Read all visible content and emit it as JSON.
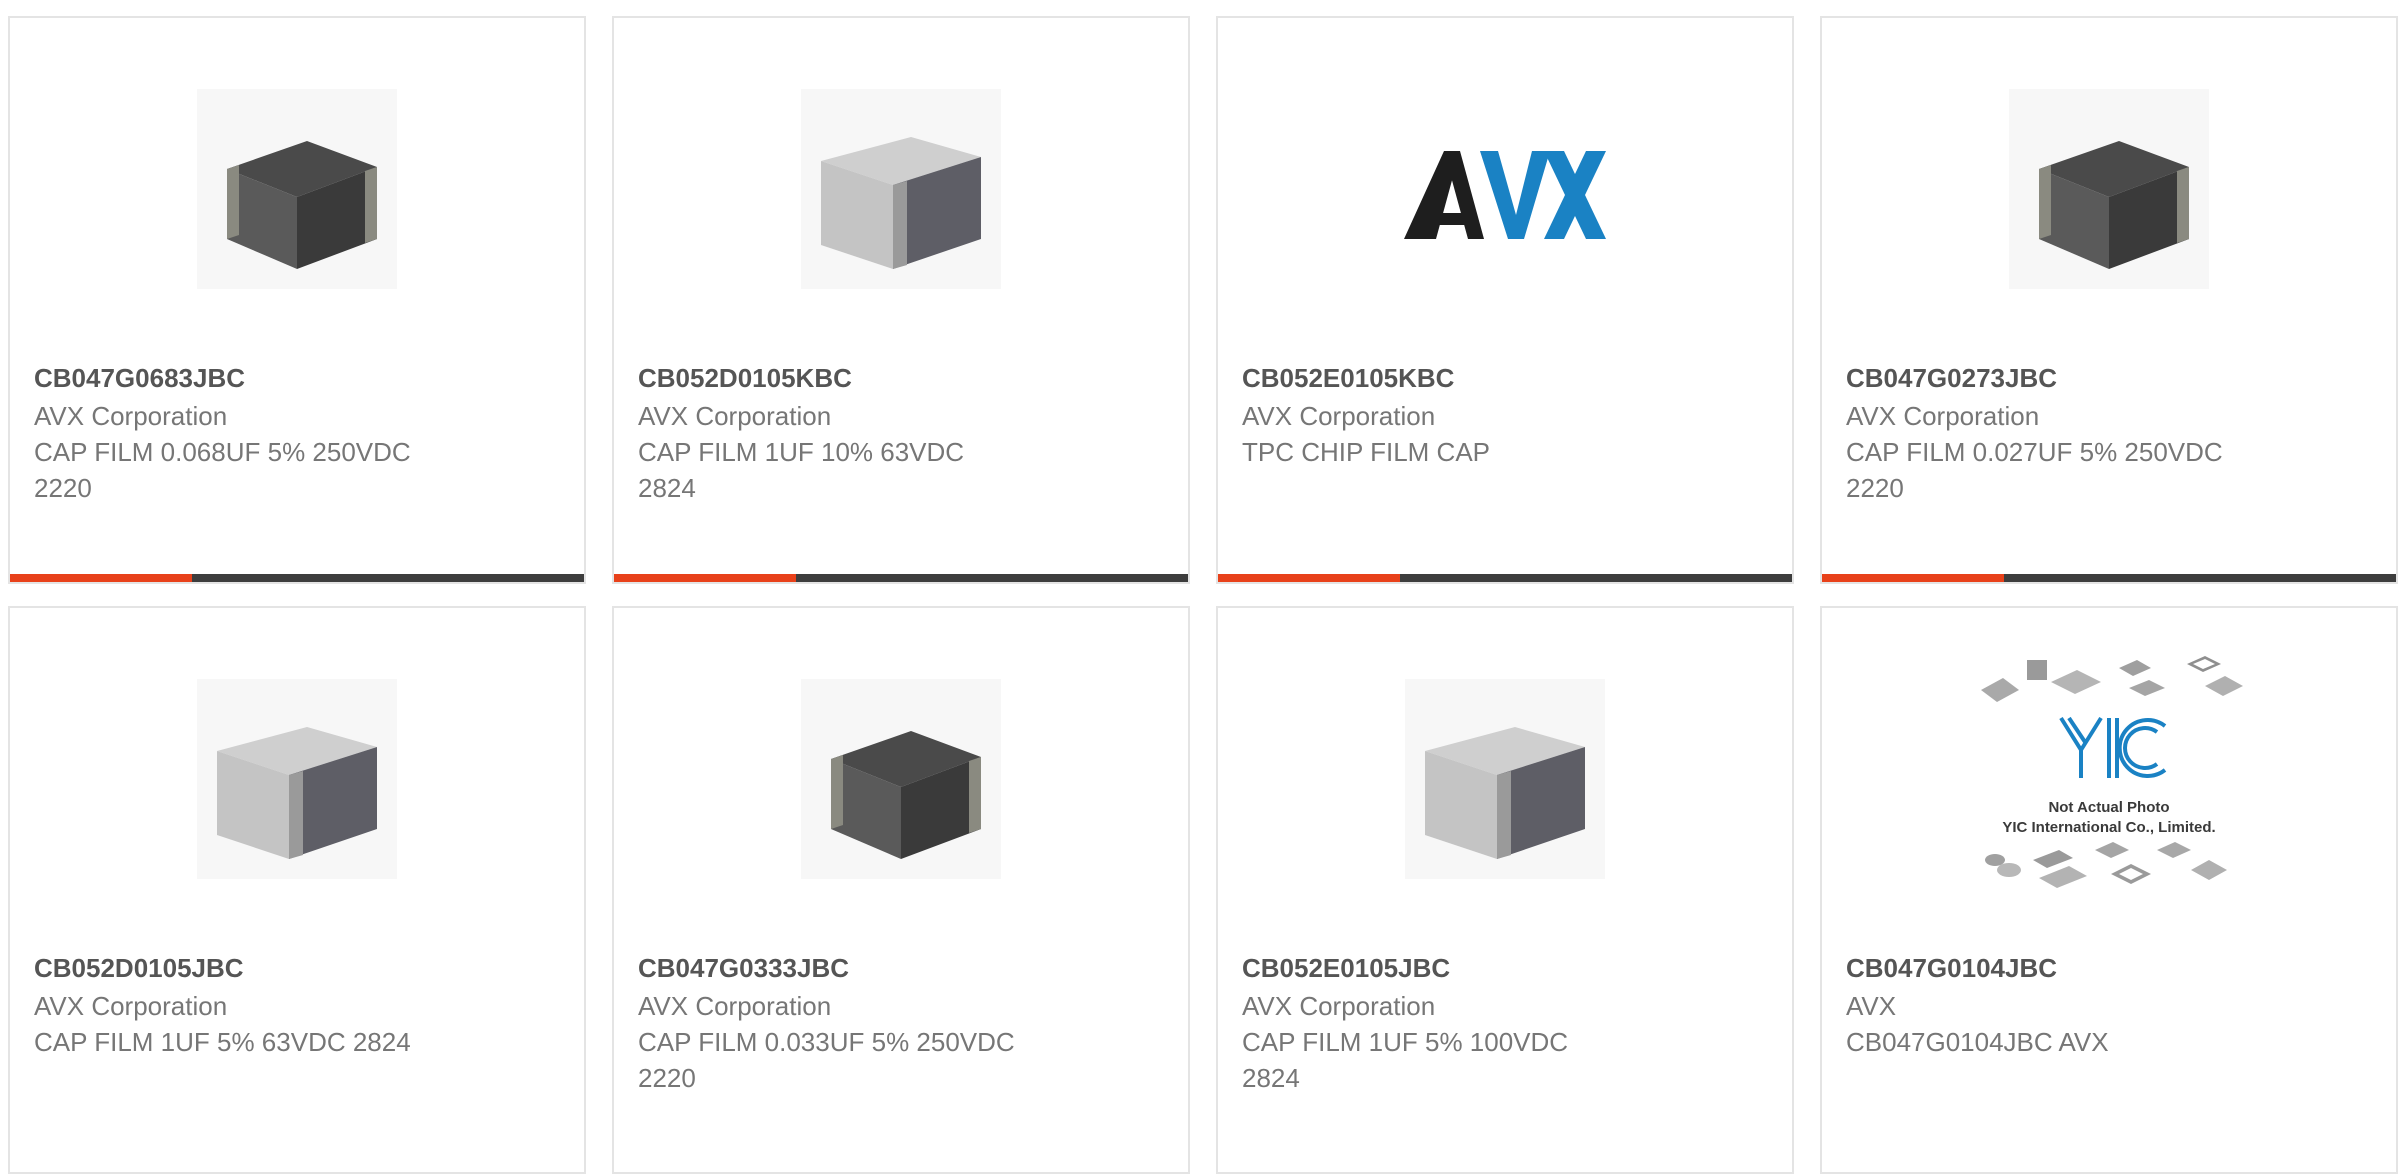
{
  "colors": {
    "accent": "#e8411a",
    "bar": "#3d3d3d",
    "border": "#e4e4e4",
    "part_number": "#555555",
    "text": "#767676"
  },
  "products": [
    {
      "part_number": "CB047G0683JBC",
      "manufacturer": "AVX Corporation",
      "description_lines": [
        "CAP FILM 0.068UF 5% 250VDC",
        "2220"
      ],
      "image": "dark-chip-capacitor-photo"
    },
    {
      "part_number": "CB052D0105KBC",
      "manufacturer": "AVX Corporation",
      "description_lines": [
        "CAP FILM 1UF 10% 63VDC",
        "2824"
      ],
      "image": "light-chip-capacitor-photo"
    },
    {
      "part_number": "CB052E0105KBC",
      "manufacturer": "AVX Corporation",
      "description_lines": [
        "TPC CHIP FILM CAP",
        ""
      ],
      "image": "avx-logo",
      "logo_text": "AVX"
    },
    {
      "part_number": "CB047G0273JBC",
      "manufacturer": "AVX Corporation",
      "description_lines": [
        "CAP FILM 0.027UF 5% 250VDC",
        "2220"
      ],
      "image": "dark-chip-capacitor-photo"
    },
    {
      "part_number": "CB052D0105JBC",
      "manufacturer": "AVX Corporation",
      "description_lines": [
        "CAP FILM 1UF 5% 63VDC 2824",
        ""
      ],
      "image": "light-chip-capacitor-photo"
    },
    {
      "part_number": "CB047G0333JBC",
      "manufacturer": "AVX Corporation",
      "description_lines": [
        "CAP FILM 0.033UF 5% 250VDC",
        "2220"
      ],
      "image": "dark-chip-capacitor-photo"
    },
    {
      "part_number": "CB052E0105JBC",
      "manufacturer": "AVX Corporation",
      "description_lines": [
        "CAP FILM 1UF 5% 100VDC",
        "2824"
      ],
      "image": "light-chip-capacitor-photo"
    },
    {
      "part_number": "CB047G0104JBC",
      "manufacturer": "AVX",
      "description_lines": [
        "CB047G0104JBC AVX",
        ""
      ],
      "image": "yic-placeholder-photo",
      "placeholder_logo": "YIC",
      "placeholder_caption_1": "Not Actual Photo",
      "placeholder_caption_2": "YIC International Co., Limited."
    }
  ]
}
